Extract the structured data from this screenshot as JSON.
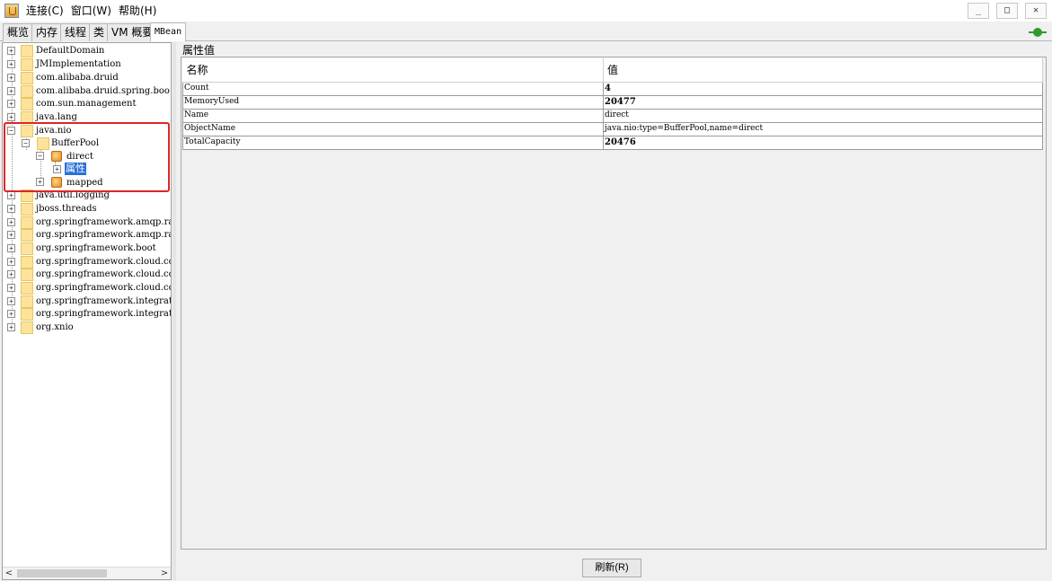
{
  "menubar": {
    "items": [
      "连接(C)",
      "窗口(W)",
      "帮助(H)"
    ],
    "window_buttons": [
      "_",
      "□",
      "✕"
    ]
  },
  "tabs": [
    "概览",
    "内存",
    "线程",
    "类",
    "VM 概要",
    "MBean"
  ],
  "tree": {
    "nodes": [
      {
        "label": "DefaultDomain"
      },
      {
        "label": "JMImplementation"
      },
      {
        "label": "com.alibaba.druid"
      },
      {
        "label": "com.alibaba.druid.spring.boo"
      },
      {
        "label": "com.sun.management"
      },
      {
        "label": "java.lang"
      },
      {
        "label": "java.nio"
      },
      {
        "label": "BufferPool"
      },
      {
        "label": "direct"
      },
      {
        "label": "属性"
      },
      {
        "label": "mapped"
      },
      {
        "label": "java.util.logging"
      },
      {
        "label": "jboss.threads"
      },
      {
        "label": "org.springframework.amqp.rab"
      },
      {
        "label": "org.springframework.amqp.rab"
      },
      {
        "label": "org.springframework.boot"
      },
      {
        "label": "org.springframework.cloud.co"
      },
      {
        "label": "org.springframework.cloud.co"
      },
      {
        "label": "org.springframework.cloud.co"
      },
      {
        "label": "org.springframework.integrat"
      },
      {
        "label": "org.springframework.integrat"
      },
      {
        "label": "org.xnio"
      }
    ],
    "scroll_left": "<",
    "scroll_right": ">"
  },
  "attributes": {
    "group_title": "属性值",
    "headers": {
      "name": "名称",
      "value": "值"
    },
    "rows": [
      {
        "name": "Count",
        "value": "4"
      },
      {
        "name": "MemoryUsed",
        "value": "20477"
      },
      {
        "name": "Name",
        "value": "direct"
      },
      {
        "name": "ObjectName",
        "value": "java.nio:type=BufferPool,name=direct"
      },
      {
        "name": "TotalCapacity",
        "value": "20476"
      }
    ]
  },
  "buttons": {
    "refresh": "刷新(R)"
  },
  "colors": {
    "selection": "#2a6fd6",
    "highlight_box": "#e02424",
    "connection_icon": "#2f9b2f"
  }
}
